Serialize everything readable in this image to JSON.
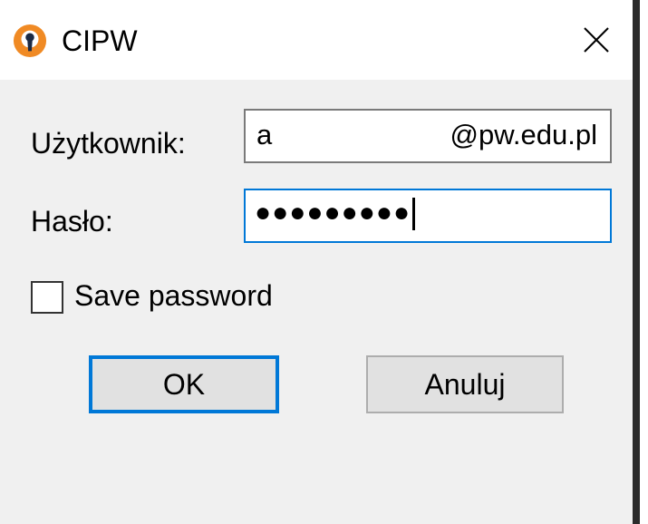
{
  "window": {
    "title": "CIPW",
    "icon": "openvpn-lock-icon",
    "close_icon": "close-icon"
  },
  "form": {
    "username_label": "Użytkownik:",
    "username_value_prefix": "a",
    "username_value_domain": "@pw.edu.pl",
    "password_label": "Hasło:",
    "password_masked": "●●●●●●●●●",
    "save_password_label": "Save password",
    "save_password_checked": false
  },
  "buttons": {
    "ok_label": "OK",
    "cancel_label": "Anuluj"
  },
  "colors": {
    "accent": "#0078d7",
    "icon_orange": "#f08a24",
    "dialog_bg": "#f0f0f0"
  }
}
